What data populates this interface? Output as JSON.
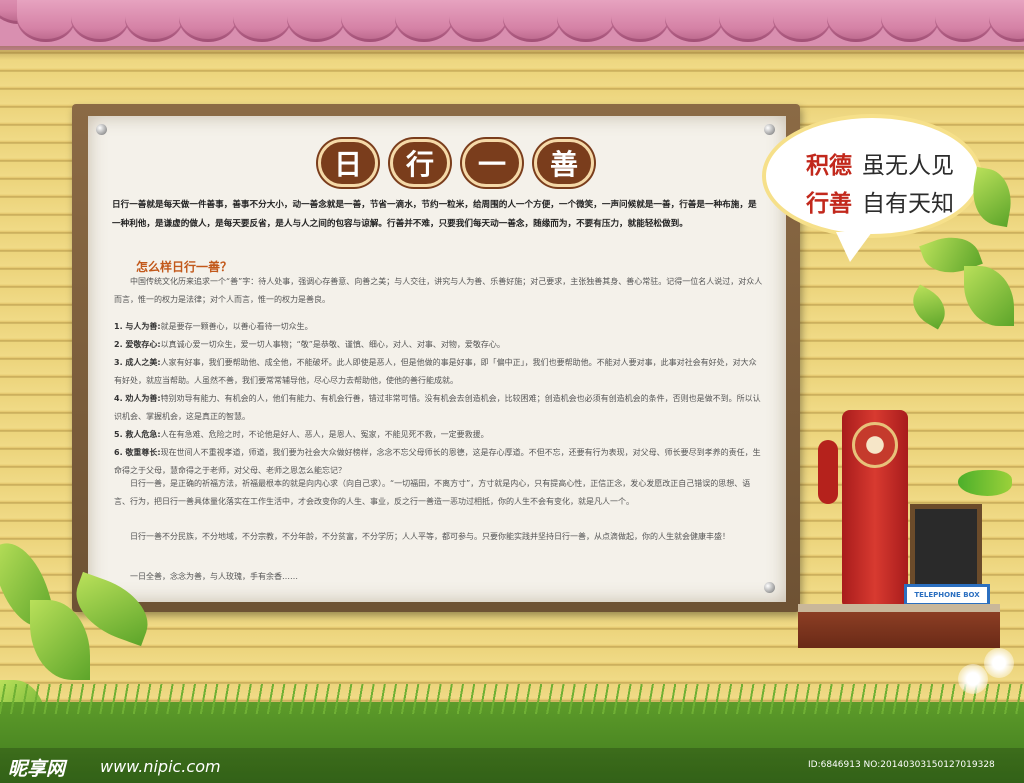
{
  "title_chars": [
    "日",
    "行",
    "一",
    "善"
  ],
  "intro": "日行一善就是每天做一件善事，善事不分大小，动一善念就是一善，节省一滴水，节约一粒米，给周围的人一个方便，一个微笑，一声问候就是一善，行善是一种布施，是一种利他，是谦虚的做人，是每天要反省，是人与人之间的包容与谅解。行善并不难，只要我们每天动一善念，随缘而为，不要有压力，就能轻松做到。",
  "subhead": "怎么样日行一善？",
  "para1": "中国传统文化历来追求一个“善”字：待人处事，强调心存善意、向善之美；与人交往，讲究与人为善、乐善好施；对己要求，主张独善其身、善心常驻。记得一位名人说过，对众人而言，惟一的权力是法律；对个人而言，惟一的权力是善良。",
  "items": [
    {
      "label": "1. 与人为善:",
      "text": "就是要存一颗善心，以善心看待一切众生。"
    },
    {
      "label": "2. 爱敬存心:",
      "text": "以真诚心爱一切众生，爱一切人事物；“敬”是恭敬、谨慎、细心，对人、对事、对物，爱敬存心。"
    },
    {
      "label": "3. 成人之美:",
      "text": "人家有好事，我们要帮助他、成全他，不能破坏。此人即使是恶人，但是他做的事是好事，即「偏中正」，我们也要帮助他。不能对人要对事，此事对社会有好处，对大众有好处，就应当帮助。人虽然不善，我们要常常辅导他，尽心尽力去帮助他，使他的善行能成就。"
    },
    {
      "label": "4. 劝人为善:",
      "text": "特别劝导有能力、有机会的人，他们有能力、有机会行善，错过非常可惜。没有机会去创造机会，比较困难；创造机会也必须有创造机会的条件，否则也是做不到。所以认识机会、掌握机会，这是真正的智慧。"
    },
    {
      "label": "5. 救人危急:",
      "text": "人在有急难、危险之时，不论他是好人、恶人，是恩人、冤家，不能见死不救，一定要救援。"
    },
    {
      "label": "6. 敬重尊长:",
      "text": "现在世间人不重视孝道，师道，我们要为社会大众做好榜样，念念不忘父母师长的恩德，这是存心厚道。不但不忘，还要有行为表现，对父母、师长要尽到孝养的责任，生命得之于父母，慧命得之于老师，对父母、老师之恩怎么能忘记？"
    }
  ],
  "para2": "日行一善，是正确的祈福方法，祈福最根本的就是向内心求（向自己求）。“一切福田，不离方寸”，方寸就是内心，只有提高心性，正信正念，发心发愿改正自己错误的思想、语言、行为，把日行一善具体量化落实在工作生活中，才会改变你的人生、事业，反之行一善造一恶功过相抵，你的人生不会有变化，就是凡人一个。",
  "para3": "日行一善不分民族，不分地域，不分宗教，不分年龄，不分贫富，不分学历；人人平等，都可参与。只要你能实践并坚持日行一善，从点滴做起，你的人生就会健康丰盛！",
  "closing": "一日全善，念念为善，与人玫瑰，手有余香……",
  "slogan": {
    "line1_red": "积德",
    "line1_dark": "虽无人见",
    "line2_red": "行善",
    "line2_dark": "自有天知"
  },
  "sign_text": "TELEPHONE BOX",
  "watermark": {
    "logo": "昵享网",
    "url": "www.nipic.com",
    "id": "ID:6846913 NO:20140303150127019328"
  },
  "colors": {
    "accent_brown": "#7a3d1c",
    "slogan_red": "#c2281c",
    "subhead_orange": "#c2581a"
  }
}
